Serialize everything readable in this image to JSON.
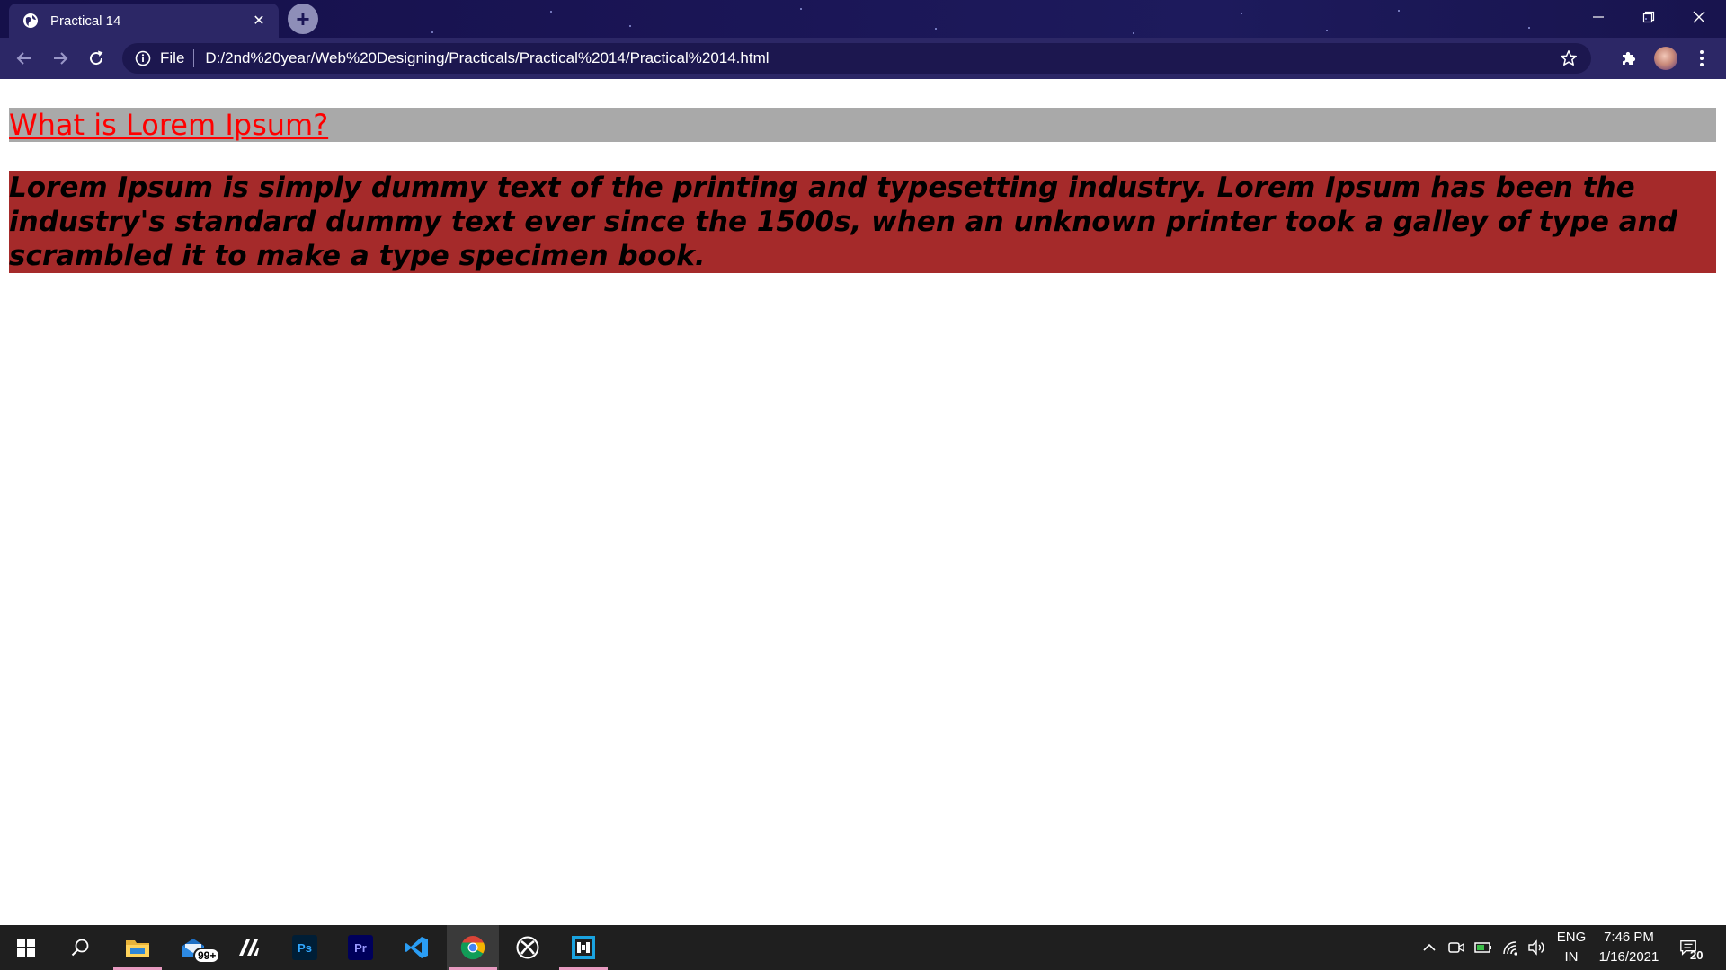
{
  "browser": {
    "tab": {
      "title": "Practical 14",
      "close_glyph": "✕"
    },
    "new_tab_glyph": "+",
    "address_bar": {
      "scheme_label": "File",
      "url": "D:/2nd%20year/Web%20Designing/Practicals/Practical%2014/Practical%2014.html"
    },
    "icons": {
      "back": "back-arrow-icon",
      "forward": "forward-arrow-icon",
      "reload": "reload-icon",
      "info": "info-icon",
      "bookmark": "star-icon",
      "extensions": "puzzle-icon",
      "menu": "kebab-menu-icon"
    },
    "window_controls": [
      "minimize-icon",
      "restore-icon",
      "close-icon"
    ]
  },
  "page": {
    "heading": "What is Lorem Ipsum?",
    "paragraph": "Lorem Ipsum is simply dummy text of the printing and typesetting industry. Lorem Ipsum has been the industry's standard dummy text ever since the 1500s, when an unknown printer took a galley of type and scrambled it to make a type specimen book.",
    "colors": {
      "heading_text": "#ff0000",
      "heading_background": "#a9a9a9",
      "paragraph_text": "#000000",
      "paragraph_background": "#a52a2a"
    }
  },
  "taskbar": {
    "apps": [
      {
        "name": "windows-start-icon"
      },
      {
        "name": "search-icon"
      },
      {
        "name": "file-explorer-icon"
      },
      {
        "name": "mail-icon",
        "badge": "99+"
      },
      {
        "name": "pen-app-icon"
      },
      {
        "name": "photoshop-icon",
        "label": "Ps"
      },
      {
        "name": "premiere-pro-icon",
        "label": "Pr"
      },
      {
        "name": "vscode-icon"
      },
      {
        "name": "chrome-icon"
      },
      {
        "name": "xbox-icon"
      },
      {
        "name": "frame-app-icon"
      }
    ],
    "tray": {
      "language": "ENG",
      "region": "IN",
      "time": "7:46 PM",
      "date": "1/16/2021",
      "notification_count": "20"
    }
  }
}
